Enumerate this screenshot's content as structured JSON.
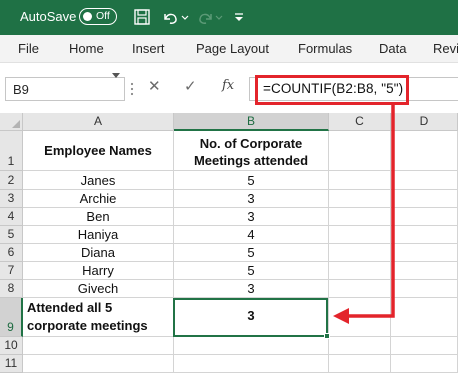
{
  "titlebar": {
    "autosave_label": "AutoSave",
    "toggle_state": "Off",
    "icons": [
      "save-icon",
      "undo-icon",
      "undo-dropdown-icon",
      "redo-icon",
      "redo-dropdown-icon",
      "customize-toolbar-icon"
    ]
  },
  "ribbon": {
    "tabs": [
      "File",
      "Home",
      "Insert",
      "Page Layout",
      "Formulas",
      "Data",
      "Revi"
    ]
  },
  "formula_bar": {
    "name_box": "B9",
    "cancel_symbol": "✕",
    "enter_symbol": "✓",
    "fx_symbol": "fx",
    "formula": "=COUNTIF(B2:B8, \"5\")"
  },
  "grid": {
    "columns": [
      "A",
      "B",
      "C",
      "D"
    ],
    "rows": [
      "1",
      "2",
      "3",
      "4",
      "5",
      "6",
      "7",
      "8",
      "9",
      "10",
      "11"
    ],
    "header": {
      "a1": "Employee Names",
      "b1_line1": "No. of Corporate",
      "b1_line2": "Meetings attended"
    },
    "data_rows": [
      {
        "name": "Janes",
        "meetings": "5"
      },
      {
        "name": "Archie",
        "meetings": "3"
      },
      {
        "name": "Ben",
        "meetings": "3"
      },
      {
        "name": "Haniya",
        "meetings": "4"
      },
      {
        "name": "Diana",
        "meetings": "5"
      },
      {
        "name": "Harry",
        "meetings": "5"
      },
      {
        "name": "Givech",
        "meetings": "3"
      }
    ],
    "summary": {
      "a9_line1": "Attended all 5",
      "a9_line2": "corporate meetings",
      "b9": "3"
    },
    "active_cell": "B9"
  },
  "colors": {
    "title_bar": "#1f7145",
    "selection": "#217346",
    "annotation": "#e3242b"
  }
}
